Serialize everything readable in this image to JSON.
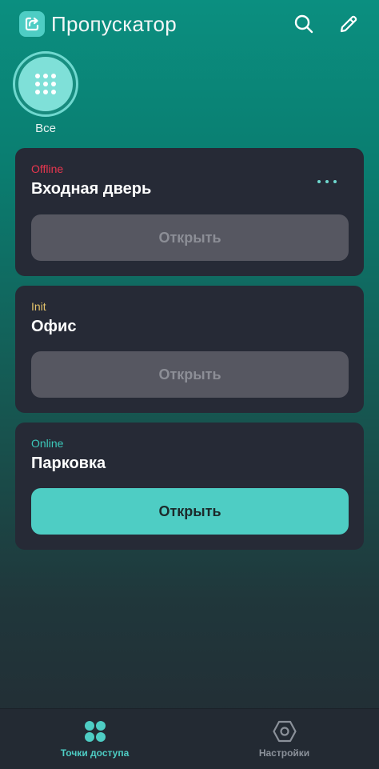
{
  "header": {
    "title": "Пропускатор",
    "logo_icon": "exit-arrow-icon",
    "search_icon": "search-icon",
    "edit_icon": "pencil-icon"
  },
  "groups": [
    {
      "label": "Все",
      "icon": "grid-dots-icon"
    }
  ],
  "cards": [
    {
      "status": "Offline",
      "status_color": "#e8364f",
      "name": "Входная дверь",
      "button_label": "Открыть",
      "button_enabled": false,
      "has_menu": true
    },
    {
      "status": "Init",
      "status_color": "#e3c26b",
      "name": "Офис",
      "button_label": "Открыть",
      "button_enabled": false,
      "has_menu": false
    },
    {
      "status": "Online",
      "status_color": "#3cc8ba",
      "name": "Парковка",
      "button_label": "Открыть",
      "button_enabled": true,
      "has_menu": false
    }
  ],
  "bottom_nav": [
    {
      "label": "Точки доступа",
      "icon": "four-circles-icon",
      "active": true,
      "color": "#4ecdc4"
    },
    {
      "label": "Настройки",
      "icon": "hexagon-settings-icon",
      "active": false,
      "color": "#8b919a"
    }
  ],
  "colors": {
    "accent": "#4ecdc4",
    "card_bg": "#262a36",
    "disabled_button": "#565761"
  }
}
